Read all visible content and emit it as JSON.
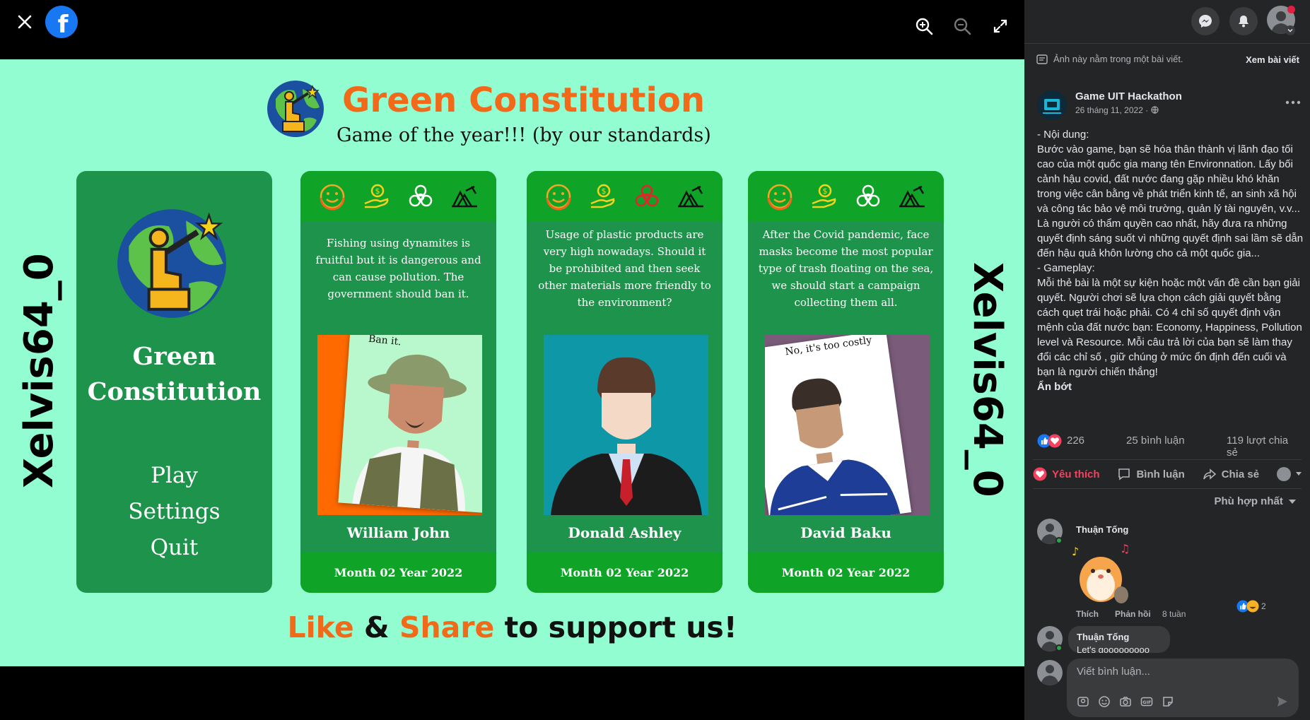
{
  "viewer": {
    "close_icon": "close-icon",
    "logo": "facebook-logo",
    "zoom_in": "zoom-in-icon",
    "zoom_out": "zoom-out-icon",
    "fullscreen": "fullscreen-icon"
  },
  "poster": {
    "title": "Green Constitution",
    "subtitle": "Game of the year!!! (by our standards)",
    "side_left": "Xelvis64_0",
    "side_right": "Xelvis64_0",
    "menu": {
      "title_line1": "Green",
      "title_line2": "Constitution",
      "items": [
        "Play",
        "Settings",
        "Quit"
      ]
    },
    "cards": [
      {
        "question": "Fishing using dynamites is fruitful but it is dangerous and can cause pollution. The government should ban it.",
        "swipe": "Ban it.",
        "name": "William John",
        "footer": "Month 02 Year 2022"
      },
      {
        "question": "Usage of plastic products are very high nowadays. Should it be prohibited and then seek other materials more friendly to the environment?",
        "swipe": "",
        "name": "Donald Ashley",
        "footer": "Month 02 Year 2022"
      },
      {
        "question": "After the Covid pandemic, face masks become the most popular type of trash floating on the sea, we should start a campaign collecting them all.",
        "swipe": "No, it's too costly",
        "name": "David Baku",
        "footer": "Month 02 Year 2022"
      }
    ],
    "cta": {
      "like": "Like",
      "amp": " & ",
      "share": "Share",
      "rest": " to support us!"
    }
  },
  "panel": {
    "notice": "Ảnh này nằm trong một bài viết.",
    "see_post": "Xem bài viết",
    "page_name": "Game UIT Hackathon",
    "post_date": "26 tháng 11, 2022 · ",
    "post_text": "- Nội dung:\nBước vào game, bạn sẽ hóa thân thành vị lãnh đạo tối cao của một quốc gia mang tên Environnation. Lấy bối cảnh hậu covid, đất nước đang gặp nhiều khó khăn trong việc cân bằng về phát triển kinh tế, an sinh xã hội và công tác bảo vệ môi trường, quản lý tài nguyên, v.v... Là người có thẩm quyền cao nhất, hãy đưa ra những quyết định sáng suốt vì những quyết định sai lầm sẽ dẫn đến hậu quả khôn lường cho cả một quốc gia...\n- Gameplay:\nMỗi thẻ bài là một sự kiện hoặc một vấn đề cần bạn giải quyết. Người chơi sẽ lựa chọn cách giải quyết bằng cách quẹt trái hoặc phải. Có 4 chỉ số quyết định vận mệnh của đất nước bạn: Economy, Happiness, Pollution level và Resource. Mỗi câu trả lời của bạn sẽ làm thay đổi các chỉ số , giữ chúng ở mức ổn định đến cuối và bạn là người chiến thắng!",
    "see_less": "Ẩn bớt",
    "reactions": "226",
    "comments_count": "25 bình luận",
    "shares_count": "119 lượt chia sẻ",
    "actions": {
      "like": "Yêu thích",
      "comment": "Bình luận",
      "share": "Chia sẻ"
    },
    "sort": "Phù hợp nhất",
    "comments": [
      {
        "author": "Thuận Tống",
        "like": "Thích",
        "reply": "Phản hồi",
        "time": "8 tuần",
        "reaction_count": "2"
      },
      {
        "author": "Thuận Tống",
        "text": "Let's gooooooooo"
      }
    ],
    "composer_placeholder": "Viết bình luận...",
    "accent": "#f3425f"
  }
}
